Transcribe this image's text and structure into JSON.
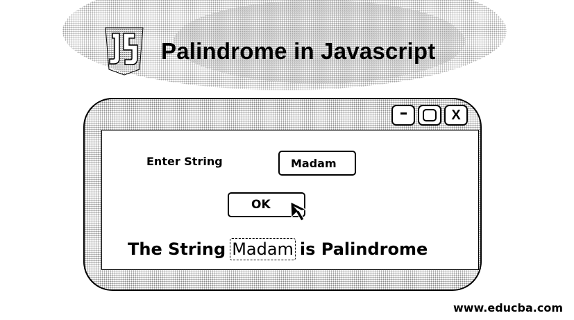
{
  "header": {
    "logo_icon": "javascript-logo-icon",
    "title": "Palindrome in Javascript"
  },
  "window": {
    "controls": {
      "minimize_icon": "minimize-icon",
      "maximize_icon": "maximize-icon",
      "close_label": "X"
    }
  },
  "form": {
    "label": "Enter String",
    "input_value": "Madam",
    "ok_label": "OK",
    "cursor_icon": "mouse-pointer-icon"
  },
  "result": {
    "prefix": "The String",
    "word": "Madam",
    "suffix": "is Palindrome"
  },
  "footer": {
    "url": "www.educba.com"
  }
}
